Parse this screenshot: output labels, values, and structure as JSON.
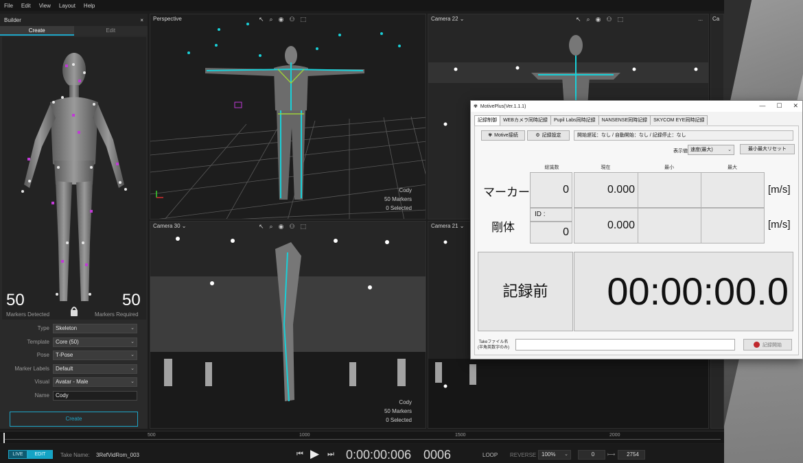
{
  "menu": [
    "File",
    "Edit",
    "View",
    "Layout",
    "Help"
  ],
  "builder": {
    "title": "Builder",
    "close": "×",
    "tabs": {
      "create": "Create",
      "edit": "Edit"
    },
    "markers_detected": "50",
    "markers_detected_label": "Markers Detected",
    "markers_required": "50",
    "markers_required_label": "Markers Required",
    "props": [
      {
        "label": "Type",
        "value": "Skeleton",
        "dropdown": true
      },
      {
        "label": "Template",
        "value": "Core (50)",
        "dropdown": true
      },
      {
        "label": "Pose",
        "value": "T-Pose",
        "dropdown": true
      },
      {
        "label": "Marker Labels",
        "value": "Default",
        "dropdown": true
      },
      {
        "label": "Visual",
        "value": "Avatar - Male",
        "dropdown": true
      },
      {
        "label": "Name",
        "value": "Cody",
        "dropdown": false
      }
    ],
    "create_button": "Create"
  },
  "viewports": {
    "perspective": {
      "title": "Perspective",
      "info_name": "Cody",
      "info_markers": "50 Markers",
      "info_selected": "0 Selected"
    },
    "camera22": {
      "title": "Camera 22 ⌄",
      "menu": "..."
    },
    "camera30": {
      "title": "Camera 30 ⌄",
      "info_name": "Cody",
      "info_markers": "50 Markers",
      "info_selected": "0 Selected"
    },
    "camera21": {
      "title": "Camera 21 ⌄"
    },
    "cropped": {
      "title": "Ca"
    }
  },
  "timeline": {
    "ticks": [
      "500",
      "1000",
      "1500",
      "2000"
    ],
    "live": "LIVE",
    "edit": "EDIT",
    "take_label": "Take Name:",
    "take_name": "3RefVidRom_003",
    "timecode": "0:00:00:006",
    "frame": "0006",
    "loop": "LOOP",
    "reverse": "REVERSE",
    "zoom": "100%",
    "start": "0",
    "end": "2754"
  },
  "motiveplus": {
    "title": "MotivePlus(Ver.1.1.1)",
    "tabs": [
      "記録制御",
      "WEBカメラ同時記録",
      "Pupil Labs同時記録",
      "NANSENSE同時記録",
      "SKYCOM EYE同時記録"
    ],
    "btn_connect": "Motive接続",
    "btn_settings": "記録設定",
    "status": "開始遅延：なし / 自動開始：なし / 記録停止：なし",
    "display_label": "表示値",
    "display_value": "速度(最大)",
    "reset_button": "最小最大リセット",
    "col_total": "総識数",
    "col_current": "現在",
    "col_min": "最小",
    "col_max": "最大",
    "row_marker": "マーカー",
    "row_rigid": "剛体",
    "marker_total": "0",
    "marker_current": "0.000",
    "rigid_id_label": "ID :",
    "rigid_total": "0",
    "rigid_current": "0.000",
    "unit": "[m/s]",
    "state": "記録前",
    "timer": "00:00:00.0",
    "take_label_1": "Takeファイル名",
    "take_label_2": "(半角英数字のみ)",
    "record_button": "記録開始"
  },
  "colors": {
    "accent": "#1ea7c9",
    "bone": "#19d0d8",
    "marker": "#c03ad6",
    "record": "#c0282d"
  }
}
